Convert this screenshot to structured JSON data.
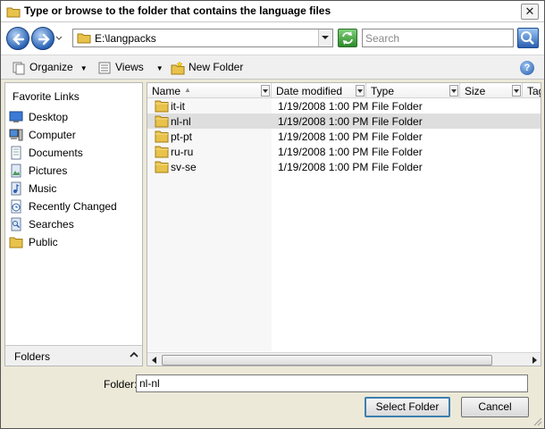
{
  "window": {
    "title": "Type or browse to the folder that contains the language files",
    "close_glyph": "✕"
  },
  "address": {
    "path": "E:\\langpacks",
    "search_placeholder": "Search"
  },
  "toolbar": {
    "organize_label": "Organize",
    "views_label": "Views",
    "new_folder_label": "New Folder",
    "help_glyph": "?"
  },
  "sidebar": {
    "title": "Favorite Links",
    "items": [
      {
        "label": "Desktop",
        "icon": "desktop-icon"
      },
      {
        "label": "Computer",
        "icon": "computer-icon"
      },
      {
        "label": "Documents",
        "icon": "documents-icon"
      },
      {
        "label": "Pictures",
        "icon": "pictures-icon"
      },
      {
        "label": "Music",
        "icon": "music-icon"
      },
      {
        "label": "Recently Changed",
        "icon": "recent-icon"
      },
      {
        "label": "Searches",
        "icon": "searches-icon"
      },
      {
        "label": "Public",
        "icon": "public-folder-icon"
      }
    ],
    "folders_label": "Folders"
  },
  "filelist": {
    "columns": [
      "Name",
      "Date modified",
      "Type",
      "Size",
      "Tags"
    ],
    "columns_visible": [
      "Name",
      "Date modified",
      "Type",
      "Size",
      "Tag"
    ],
    "rows": [
      {
        "name": "it-it",
        "date": "1/19/2008 1:00 PM",
        "type": "File Folder",
        "selected": false
      },
      {
        "name": "nl-nl",
        "date": "1/19/2008 1:00 PM",
        "type": "File Folder",
        "selected": true
      },
      {
        "name": "pt-pt",
        "date": "1/19/2008 1:00 PM",
        "type": "File Folder",
        "selected": false
      },
      {
        "name": "ru-ru",
        "date": "1/19/2008 1:00 PM",
        "type": "File Folder",
        "selected": false
      },
      {
        "name": "sv-se",
        "date": "1/19/2008 1:00 PM",
        "type": "File Folder",
        "selected": false
      }
    ]
  },
  "footer": {
    "folder_label": "Folder:",
    "folder_value": "nl-nl",
    "select_button": "Select Folder",
    "cancel_button": "Cancel"
  },
  "colors": {
    "folder_yellow": "#e8c24a",
    "selected_row": "#dedede",
    "nav_blue": "#2a64b5"
  }
}
